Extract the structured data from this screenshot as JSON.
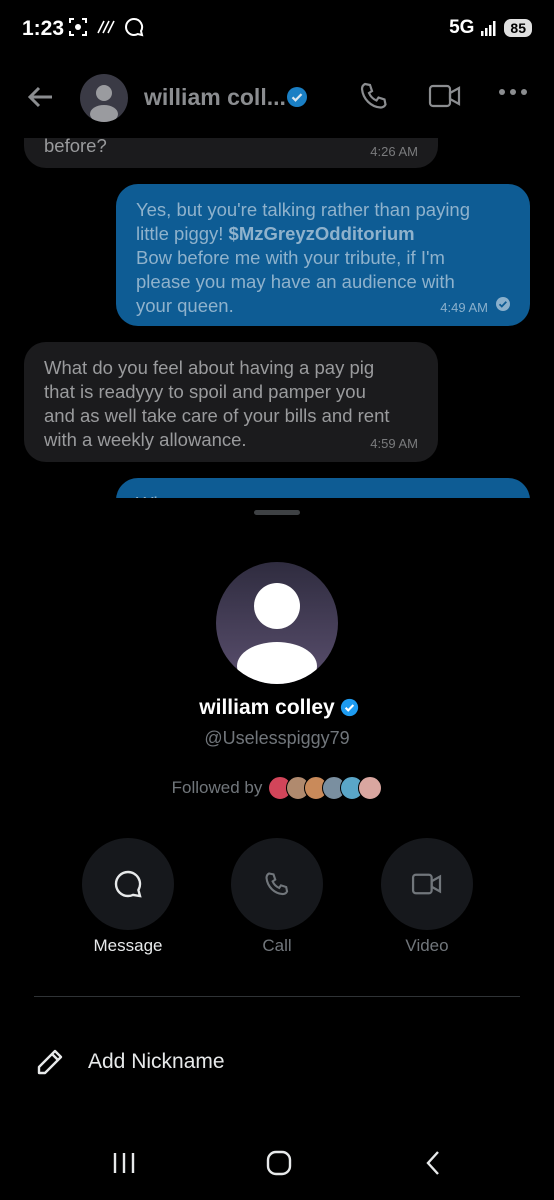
{
  "status_bar": {
    "time": "1:23",
    "network": "5G",
    "battery": "85"
  },
  "chat": {
    "header": {
      "name": "william coll..."
    },
    "messages": [
      {
        "side": "in",
        "text_lines": [
          "before?"
        ],
        "time": "4:26 AM"
      },
      {
        "side": "out",
        "text_lines": [
          "Yes, but you're talking rather than paying",
          "little piggy! ",
          "Bow before me with your tribute, if I'm",
          "please you may have an audience with",
          "your queen."
        ],
        "cashtag": "$MzGreyzOdditorium",
        "time": "4:49 AM"
      },
      {
        "side": "in",
        "text_lines": [
          "What  do you feel about having a pay pig",
          "that is readyyy to spoil  and pamper you",
          "and as well take care of your bills and rent",
          "with a weekly allowance."
        ],
        "time": "4:59 AM"
      },
      {
        "side": "out",
        "text_lines": [
          "Wh..."
        ],
        "time": ""
      }
    ]
  },
  "profile_sheet": {
    "name": "william colley",
    "handle": "@Uselesspiggy79",
    "followed_by_label": "Followed by",
    "actions": [
      {
        "label": "Message",
        "icon": "message-icon",
        "enabled": true
      },
      {
        "label": "Call",
        "icon": "phone-icon",
        "enabled": false
      },
      {
        "label": "Video",
        "icon": "video-icon",
        "enabled": false
      }
    ],
    "add_nickname_label": "Add Nickname"
  },
  "colors": {
    "verified": "#1d9bf0",
    "sheet_bg": "#000000",
    "action_bg": "#16181c"
  }
}
